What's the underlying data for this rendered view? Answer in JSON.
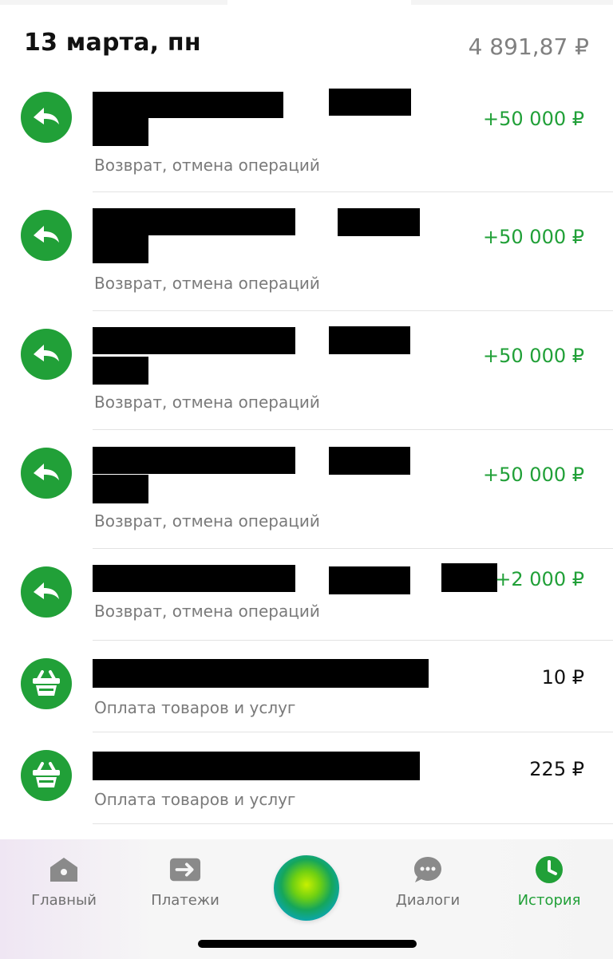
{
  "header": {
    "date": "13 марта, пн",
    "total": "4 891,87 ₽"
  },
  "transactions": [
    {
      "category": "Возврат, отмена операций",
      "amount": "+50 000 ₽",
      "icon": "return-arrow-icon",
      "positive": true
    },
    {
      "category": "Возврат, отмена операций",
      "amount": "+50 000 ₽",
      "icon": "return-arrow-icon",
      "positive": true
    },
    {
      "category": "Возврат, отмена операций",
      "amount": "+50 000 ₽",
      "icon": "return-arrow-icon",
      "positive": true
    },
    {
      "category": "Возврат, отмена операций",
      "amount": "+50 000 ₽",
      "icon": "return-arrow-icon",
      "positive": true
    },
    {
      "category": "Возврат, отмена операций",
      "amount": "+2 000 ₽",
      "icon": "return-arrow-icon",
      "positive": true
    },
    {
      "category": "Оплата товаров и услуг",
      "amount": "10 ₽",
      "icon": "basket-icon",
      "positive": false
    },
    {
      "category": "Оплата товаров и услуг",
      "amount": "225 ₽",
      "icon": "basket-icon",
      "positive": false
    }
  ],
  "tabbar": {
    "home": "Главный",
    "payments": "Платежи",
    "dialogs": "Диалоги",
    "history": "История",
    "active": "history"
  },
  "colors": {
    "accent": "#21a038",
    "muted": "#7a7a7a"
  }
}
